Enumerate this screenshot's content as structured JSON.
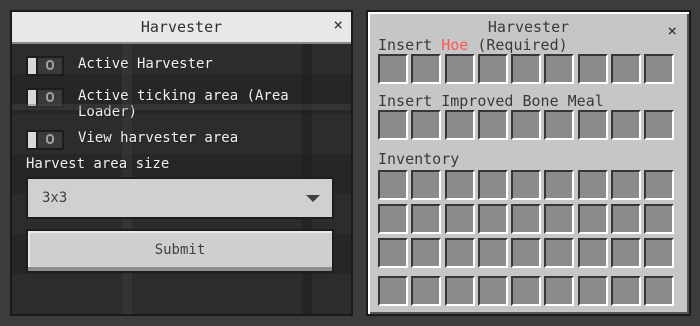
{
  "harvester_settings": {
    "title": "Harvester",
    "close_icon": "×",
    "toggles": [
      {
        "label": "Active Harvester",
        "state": "off",
        "icon": "toggle-switch"
      },
      {
        "label": "Active ticking area (Area Loader)",
        "state": "off",
        "icon": "toggle-switch"
      },
      {
        "label": "View harvester area",
        "state": "off",
        "icon": "toggle-switch"
      }
    ],
    "area_size_label": "Harvest area size",
    "area_size_value": "3x3",
    "dropdown_icon": "caret-down-icon",
    "submit_label": "Submit"
  },
  "harvester_inventory": {
    "title": "Harvester",
    "close_icon": "×",
    "hoe_label_prefix": "Insert",
    "hoe_label_highlight": "Hoe",
    "hoe_label_suffix": "(Required)",
    "hoe_highlight_color": "#ff5555",
    "bone_meal_label": "Insert Improved Bone Meal",
    "inventory_label": "Inventory",
    "slots_per_row": 9,
    "inventory_rows": 3,
    "hotbar_rows": 1
  },
  "colors": {
    "panel": "#c6c6c6",
    "slot": "#8b8b8b",
    "background": "#2a2a2a"
  }
}
